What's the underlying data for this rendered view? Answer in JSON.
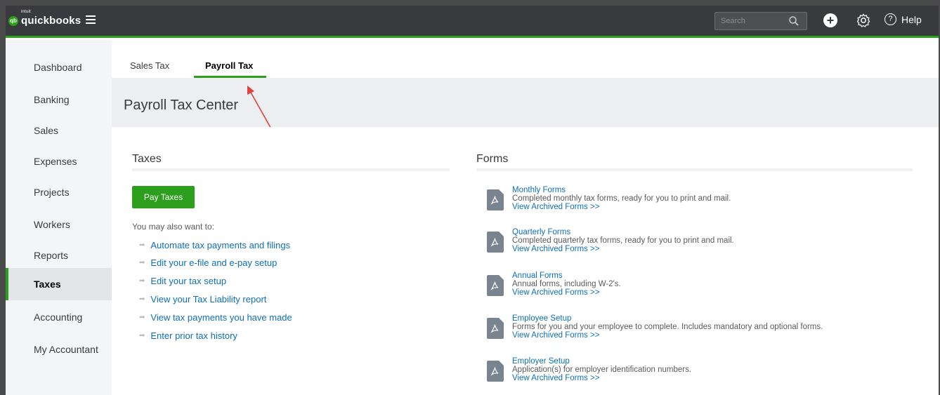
{
  "app": {
    "logo_small": "intuit",
    "logo_text": "quickbooks",
    "logo_badge": "qb",
    "search_placeholder": "Search",
    "help_label": "Help",
    "accent_color": "#2ca01c",
    "link_color": "#0d6fb8"
  },
  "sidebar": {
    "items": [
      {
        "label": "Dashboard"
      },
      {
        "label": "Banking"
      },
      {
        "label": "Sales"
      },
      {
        "label": "Expenses"
      },
      {
        "label": "Projects"
      },
      {
        "label": "Workers"
      },
      {
        "label": "Reports"
      },
      {
        "label": "Taxes",
        "active": true
      },
      {
        "label": "Accounting"
      },
      {
        "label": "My Accountant"
      }
    ]
  },
  "tabs": [
    {
      "label": "Sales Tax"
    },
    {
      "label": "Payroll Tax",
      "active": true
    }
  ],
  "page": {
    "title": "Payroll Tax Center"
  },
  "taxes": {
    "title": "Taxes",
    "pay_button": "Pay Taxes",
    "also_label": "You may also want to:",
    "links": [
      "Automate tax payments and filings",
      "Edit your e-file and e-pay setup",
      "Edit your tax setup",
      "View your Tax Liability report",
      "View tax payments you have made",
      "Enter prior tax history"
    ]
  },
  "forms": {
    "title": "Forms",
    "items": [
      {
        "name": "Monthly Forms",
        "desc": "Completed monthly tax forms, ready for you to print and mail.",
        "archive": "View Archived Forms >>"
      },
      {
        "name": "Quarterly Forms",
        "desc": "Completed quarterly tax forms, ready for you to print and mail.",
        "archive": "View Archived Forms >>"
      },
      {
        "name": "Annual Forms",
        "desc": "Annual forms, including W-2's.",
        "archive": "View Archived Forms >>"
      },
      {
        "name": "Employee Setup",
        "desc": "Forms for you and your employee to complete. Includes mandatory and optional forms.",
        "archive": "View Archived Forms >>"
      },
      {
        "name": "Employer Setup",
        "desc": "Application(s) for employer identification numbers.",
        "archive": "View Archived Forms >>"
      }
    ]
  }
}
